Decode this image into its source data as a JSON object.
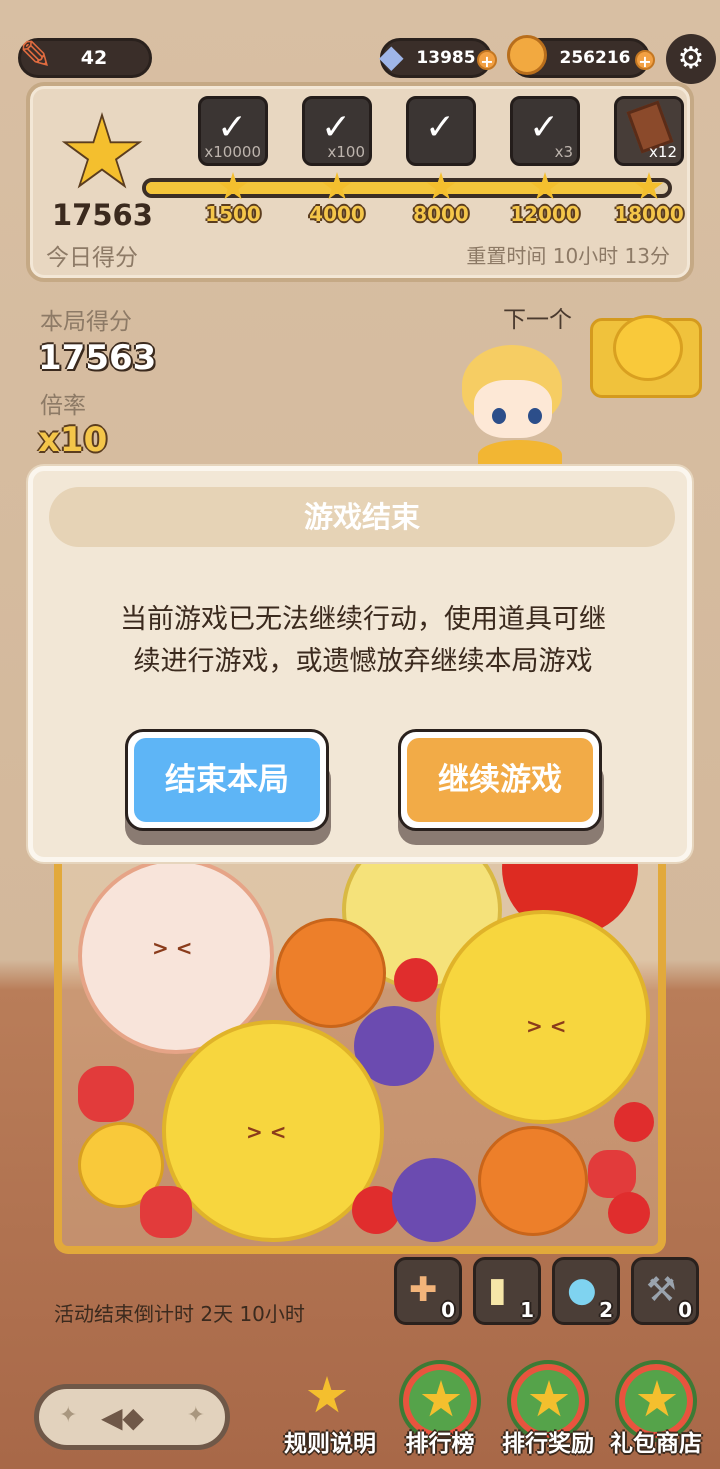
{
  "top_bar": {
    "stamina": "42",
    "gems": "13985",
    "coins": "256216"
  },
  "daily_panel": {
    "score": "17563",
    "score_label": "今日得分",
    "reset_text": "重置时间 10小时 13分",
    "progress_fraction": 0.96,
    "rewards": [
      {
        "qty": "x10000",
        "claimed": true
      },
      {
        "qty": "x100",
        "claimed": true
      },
      {
        "qty": "",
        "claimed": true
      },
      {
        "qty": "x3",
        "claimed": true
      },
      {
        "qty": "x12",
        "claimed": false
      }
    ],
    "milestones": [
      "1500",
      "4000",
      "8000",
      "12000",
      "18000"
    ]
  },
  "session": {
    "score_label": "本局得分",
    "score": "17563",
    "multiplier_label": "倍率",
    "multiplier": "x10",
    "next_label": "下一个"
  },
  "dialog": {
    "title": "游戏结束",
    "message_line1": "当前游戏已无法继续行动，使用道具可继",
    "message_line2": "续进行游戏，或遗憾放弃继续本局游戏",
    "end_button": "结束本局",
    "continue_button": "继续游戏"
  },
  "tools": [
    {
      "icon": "bandage-icon",
      "count": "0"
    },
    {
      "icon": "juice-bottle-icon",
      "count": "1"
    },
    {
      "icon": "magic-orb-icon",
      "count": "2"
    },
    {
      "icon": "hammer-icon",
      "count": "0"
    }
  ],
  "countdown": "活动结束倒计时 2天 10小时",
  "nav": {
    "rules": "规则说明",
    "ranking": "排行榜",
    "rank_rewards": "排行奖励",
    "gift_shop": "礼包商店"
  },
  "colors": {
    "accent_orange": "#f2ab47",
    "accent_blue": "#5eb5f6",
    "gold": "#f4bf2e"
  }
}
